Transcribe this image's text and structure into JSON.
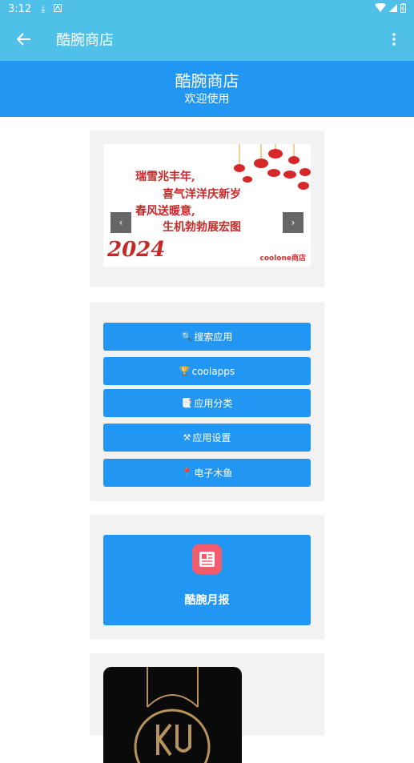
{
  "status_bar": {
    "time": "3:12",
    "icons": [
      "download-icon",
      "notification-icon",
      "wifi-icon",
      "signal-icon",
      "battery-icon"
    ]
  },
  "app_bar": {
    "title": "酷腕商店"
  },
  "header": {
    "title": "酷腕商店",
    "subtitle": "欢迎使用"
  },
  "carousel": {
    "prev_label": "‹",
    "next_label": "›",
    "banner_lines": [
      "瑞雪兆丰年,",
      "喜气洋洋庆新岁",
      "春风送暖意,",
      "生机勃勃展宏图"
    ],
    "year_text": "2024",
    "brand": "coolone商店",
    "colors": {
      "red": "#d32f2f",
      "gold": "#e0a020"
    }
  },
  "menu": {
    "items": [
      {
        "icon": "🔍",
        "label": "搜索应用"
      },
      {
        "icon": "🏆",
        "label": "coolapps"
      },
      {
        "icon": "📑",
        "label": "应用分类"
      },
      {
        "icon": "⚒",
        "label": "应用设置"
      },
      {
        "icon": "📍",
        "label": "电子木鱼"
      }
    ]
  },
  "report": {
    "label": "酷腕月报"
  },
  "colors": {
    "app_bar": "#4fc0e8",
    "primary": "#2196f3",
    "card_bg": "#f2f2f2"
  }
}
